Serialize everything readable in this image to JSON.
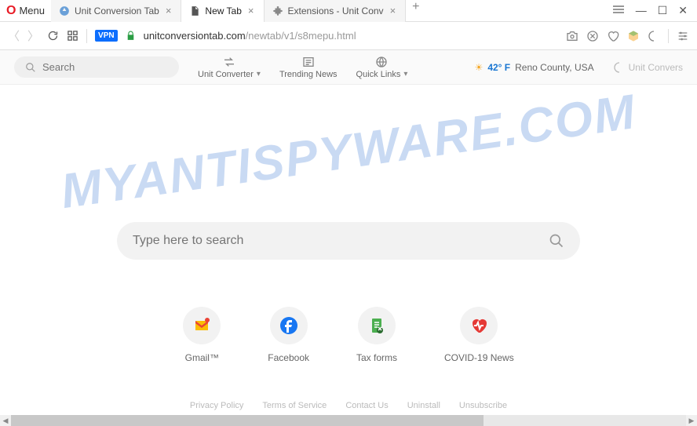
{
  "titlebar": {
    "menu_label": "Menu",
    "tabs": [
      {
        "title": "Unit Conversion Tab",
        "active": false
      },
      {
        "title": "New Tab",
        "active": true
      },
      {
        "title": "Extensions - Unit Conv",
        "active": false
      }
    ]
  },
  "addressbar": {
    "vpn_label": "VPN",
    "url_domain": "unitconversiontab.com",
    "url_path": "/newtab/v1/s8mepu.html"
  },
  "toolbar": {
    "search_placeholder": "Search",
    "items": [
      {
        "label": "Unit Converter",
        "has_chevron": true
      },
      {
        "label": "Trending News",
        "has_chevron": false
      },
      {
        "label": "Quick Links",
        "has_chevron": true
      }
    ],
    "weather": {
      "temp": "42° F",
      "location": "Reno County, USA"
    },
    "brand": "Unit Convers"
  },
  "main": {
    "search_placeholder": "Type here to search",
    "quick_links": [
      {
        "label": "Gmail™"
      },
      {
        "label": "Facebook"
      },
      {
        "label": "Tax forms"
      },
      {
        "label": "COVID-19 News"
      }
    ],
    "footer": [
      "Privacy Policy",
      "Terms of Service",
      "Contact Us",
      "Uninstall",
      "Unsubscribe"
    ]
  },
  "watermark": "MYANTISPYWARE.COM"
}
